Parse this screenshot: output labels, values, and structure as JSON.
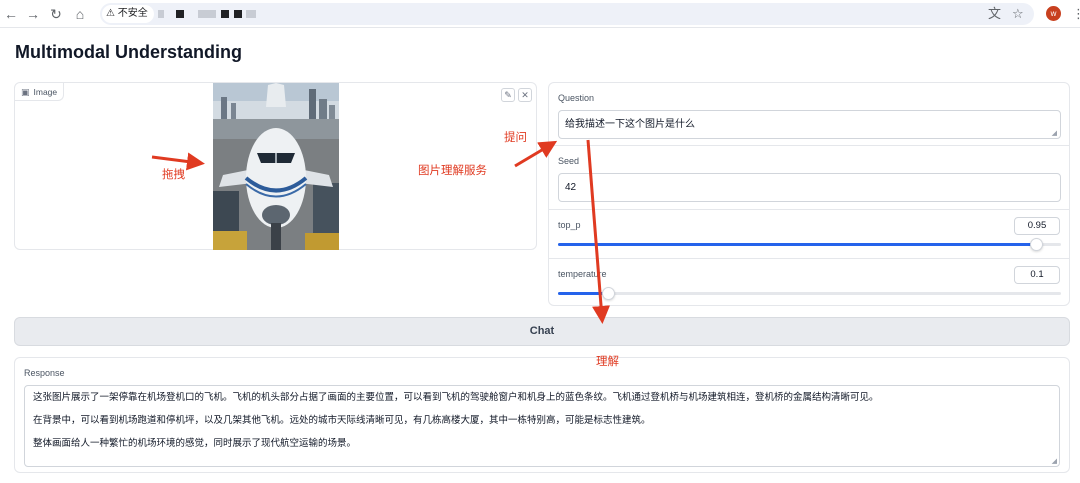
{
  "browser": {
    "insecure_label": "不安全",
    "profile_initial": "w"
  },
  "page": {
    "title": "Multimodal Understanding"
  },
  "image_input": {
    "label": "Image"
  },
  "controls": {
    "question": {
      "label": "Question",
      "value": "给我描述一下这个图片是什么"
    },
    "seed": {
      "label": "Seed",
      "value": "42"
    },
    "top_p": {
      "label": "top_p",
      "value": "0.95",
      "fraction": 0.95
    },
    "temperature": {
      "label": "temperature",
      "value": "0.1",
      "fraction": 0.1
    }
  },
  "chat_button": {
    "label": "Chat"
  },
  "response": {
    "label": "Response",
    "paragraphs": [
      "这张图片展示了一架停靠在机场登机口的飞机。飞机的机头部分占据了画面的主要位置，可以看到飞机的驾驶舱窗户和机身上的蓝色条纹。飞机通过登机桥与机场建筑相连，登机桥的金属结构清晰可见。",
      "在背景中，可以看到机场跑道和停机坪，以及几架其他飞机。远处的城市天际线清晰可见，有几栋高楼大厦，其中一栋特别高，可能是标志性建筑。",
      "整体画面给人一种繁忙的机场环境的感觉，同时展示了现代航空运输的场景。"
    ]
  },
  "annotations": {
    "drag": "拖拽",
    "service": "图片理解服务",
    "ask": "提问",
    "understand": "理解"
  },
  "colors": {
    "accent": "#2563eb",
    "annotation": "#e03a21"
  }
}
